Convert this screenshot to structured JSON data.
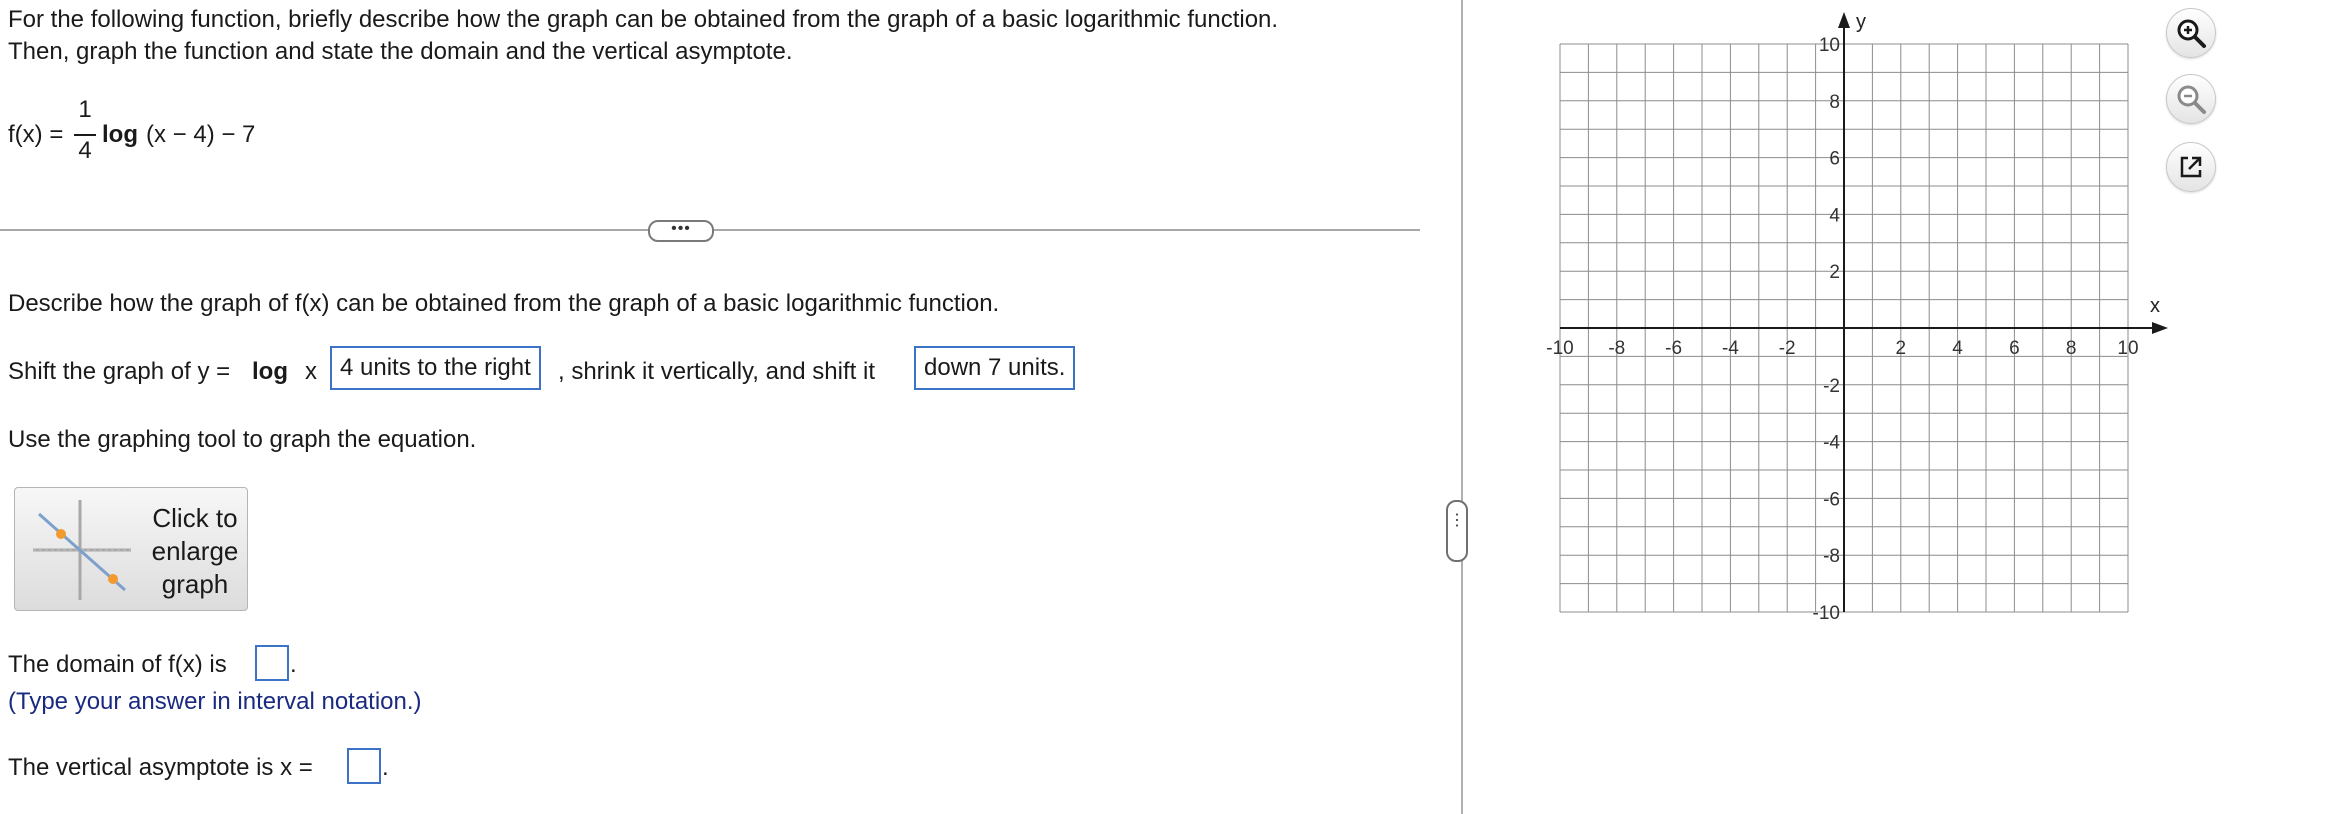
{
  "question": {
    "line1": "For the following function, briefly describe how the graph can be obtained from the graph of a basic logarithmic function.",
    "line2": "Then, graph the function and state the domain and the vertical asymptote.",
    "function": {
      "prefix": "f(x) =",
      "numerator": "1",
      "denominator": "4",
      "log_bold": "log",
      "suffix": "(x − 4) − 7"
    }
  },
  "divider_dots": "•••",
  "describe_prompt": "Describe how the graph of f(x) can be obtained from the graph of a basic logarithmic function.",
  "shift": {
    "prefix": "Shift the graph of y =",
    "log_bold": "log",
    "var": "x",
    "answer1": "4 units to the right",
    "middle": ", shrink it vertically, and shift it",
    "answer2": "down 7 units."
  },
  "tool_prompt": "Use the graphing tool to graph the equation.",
  "enlarge_button": {
    "line1": "Click to",
    "line2": "enlarge",
    "line3": "graph"
  },
  "domain": {
    "prefix": "The domain of f(x) is",
    "suffix": ".",
    "hint": "(Type your answer in interval notation.)"
  },
  "asymptote": {
    "prefix": "The vertical asymptote is x =",
    "suffix": "."
  },
  "handle_dots": "⋮",
  "graph": {
    "x_label": "x",
    "y_label": "y",
    "x_range": [
      -10,
      10
    ],
    "y_range": [
      -10,
      10
    ],
    "x_ticks": [
      "-10",
      "-8",
      "-6",
      "-4",
      "-2",
      "2",
      "4",
      "6",
      "8",
      "10"
    ],
    "y_ticks": [
      "10",
      "8",
      "6",
      "4",
      "2",
      "-2",
      "-4",
      "-6",
      "-8",
      "-10"
    ],
    "grid": true
  },
  "tools": {
    "zoom_in": "zoom-in-icon",
    "zoom_out": "zoom-out-icon",
    "popout": "external-link-icon"
  },
  "colors": {
    "accent_box": "#3b73c7",
    "hint_text": "#1a2a80",
    "thumb_point": "#f29a2e"
  }
}
